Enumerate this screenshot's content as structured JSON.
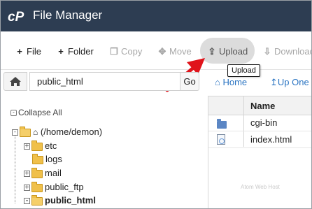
{
  "app": {
    "title": "File Manager"
  },
  "toolbar": {
    "file": "File",
    "folder": "Folder",
    "copy": "Copy",
    "move": "Move",
    "upload": "Upload",
    "download": "Download",
    "upload_tooltip": "Upload"
  },
  "pathbar": {
    "value": "public_html",
    "go": "Go"
  },
  "nav": {
    "home": "Home",
    "up_one": "Up One"
  },
  "tree": {
    "collapse_all": "Collapse All",
    "root": "(/home/demon)",
    "items": [
      "etc",
      "logs",
      "mail",
      "public_ftp",
      "public_html"
    ]
  },
  "files": {
    "header_name": "Name",
    "rows": [
      {
        "name": "cgi-bin",
        "type": "folder-icon"
      },
      {
        "name": "index.html",
        "type": "html-file-icon"
      }
    ]
  },
  "watermark": "Atom Web Host",
  "colors": {
    "header": "#2d3d52",
    "link": "#2a74c2",
    "arrow": "#e0141b"
  }
}
